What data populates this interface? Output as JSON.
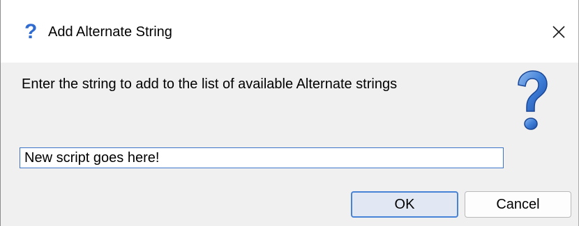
{
  "window": {
    "title": "Add Alternate String",
    "title_icon": "question-icon",
    "close_icon": "close-icon"
  },
  "message": "Enter the string to add to the list of available Alternate strings",
  "dialog_icon": "question-mark-icon",
  "input": {
    "value": "New script goes here!"
  },
  "buttons": {
    "ok_label": "OK",
    "cancel_label": "Cancel"
  },
  "colors": {
    "accent": "#2f6bd0",
    "focus_border": "#4682d6",
    "dialog_background": "#f0f0f0"
  }
}
